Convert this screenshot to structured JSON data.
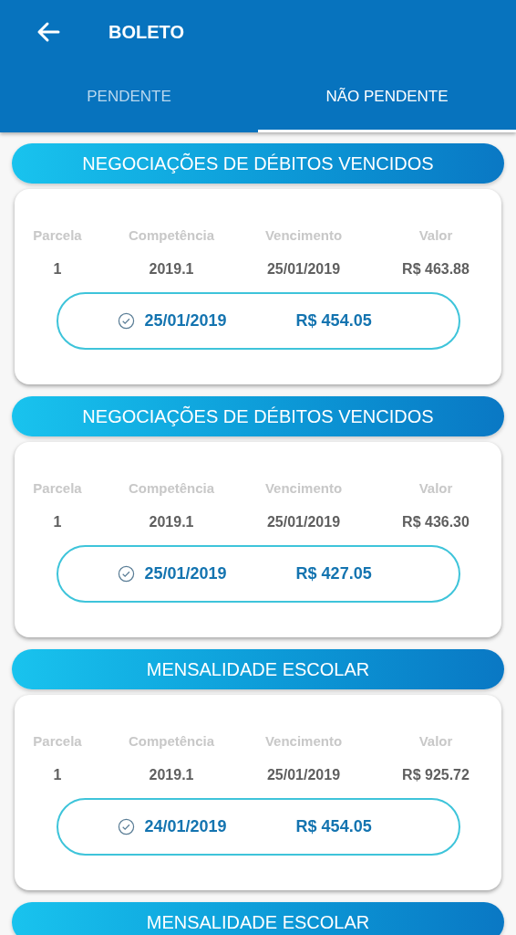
{
  "header": {
    "title": "BOLETO"
  },
  "tabs": [
    {
      "label": "PENDENTE",
      "selected": false
    },
    {
      "label": "NÃO PENDENTE",
      "selected": true
    }
  ],
  "sections": [
    {
      "title": "NEGOCIAÇÕES DE DÉBITOS VENCIDOS",
      "columns": [
        "Parcela",
        "Competência",
        "Vencimento",
        "Valor"
      ],
      "row": [
        "1",
        "2019.1",
        "25/01/2019",
        "R$ 463.88"
      ],
      "payment": {
        "date": "25/01/2019",
        "amount": "R$ 454.05"
      }
    },
    {
      "title": "NEGOCIAÇÕES DE DÉBITOS VENCIDOS",
      "columns": [
        "Parcela",
        "Competência",
        "Vencimento",
        "Valor"
      ],
      "row": [
        "1",
        "2019.1",
        "25/01/2019",
        "R$ 436.30"
      ],
      "payment": {
        "date": "25/01/2019",
        "amount": "R$ 427.05"
      }
    },
    {
      "title": "MENSALIDADE ESCOLAR",
      "columns": [
        "Parcela",
        "Competência",
        "Vencimento",
        "Valor"
      ],
      "row": [
        "1",
        "2019.1",
        "25/01/2019",
        "R$ 925.72"
      ],
      "payment": {
        "date": "24/01/2019",
        "amount": "R$ 454.05"
      }
    },
    {
      "title": "MENSALIDADE ESCOLAR"
    }
  ]
}
